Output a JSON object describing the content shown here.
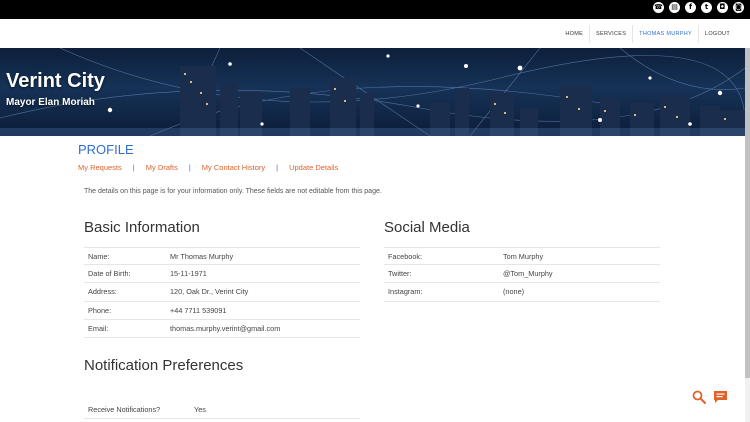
{
  "social_icons": [
    "phone-icon",
    "chat-icon",
    "facebook-icon",
    "twitter-icon",
    "instagram-icon",
    "camera-icon"
  ],
  "nav": {
    "home": "HOME",
    "services": "SERVICES",
    "user": "THOMAS MURPHY",
    "logout": "LOGOUT"
  },
  "banner": {
    "title": "Verint City",
    "subtitle": "Mayor Elan Moriah"
  },
  "profile": {
    "title": "PROFILE",
    "links": [
      "My Requests",
      "My Drafts",
      "My Contact History",
      "Update Details"
    ],
    "separator": "|",
    "info": "The details on this page is for your information only. These fields are not editable from this page."
  },
  "basic": {
    "heading": "Basic Information",
    "rows": [
      {
        "label": "Name:",
        "value": "Mr Thomas Murphy"
      },
      {
        "label": "Date of Birth:",
        "value": "15-11-1971"
      },
      {
        "label": "Address:",
        "value": "120, Oak Dr., Verint City"
      },
      {
        "label": "Phone:",
        "value": "+44 7711 539091"
      },
      {
        "label": "Email:",
        "value": "thomas.murphy.verint@gmail.com"
      }
    ]
  },
  "social": {
    "heading": "Social Media",
    "rows": [
      {
        "label": "Facebook:",
        "value": "Tom Murphy"
      },
      {
        "label": "Twitter:",
        "value": "@Tom_Murphy"
      },
      {
        "label": "Instagram:",
        "value": "(none)"
      }
    ]
  },
  "notifications": {
    "heading": "Notification Preferences",
    "rows": [
      {
        "label": "Receive Notifications?",
        "value": "Yes"
      }
    ]
  },
  "colors": {
    "accent": "#2f6fd1",
    "link": "#e0622b"
  }
}
